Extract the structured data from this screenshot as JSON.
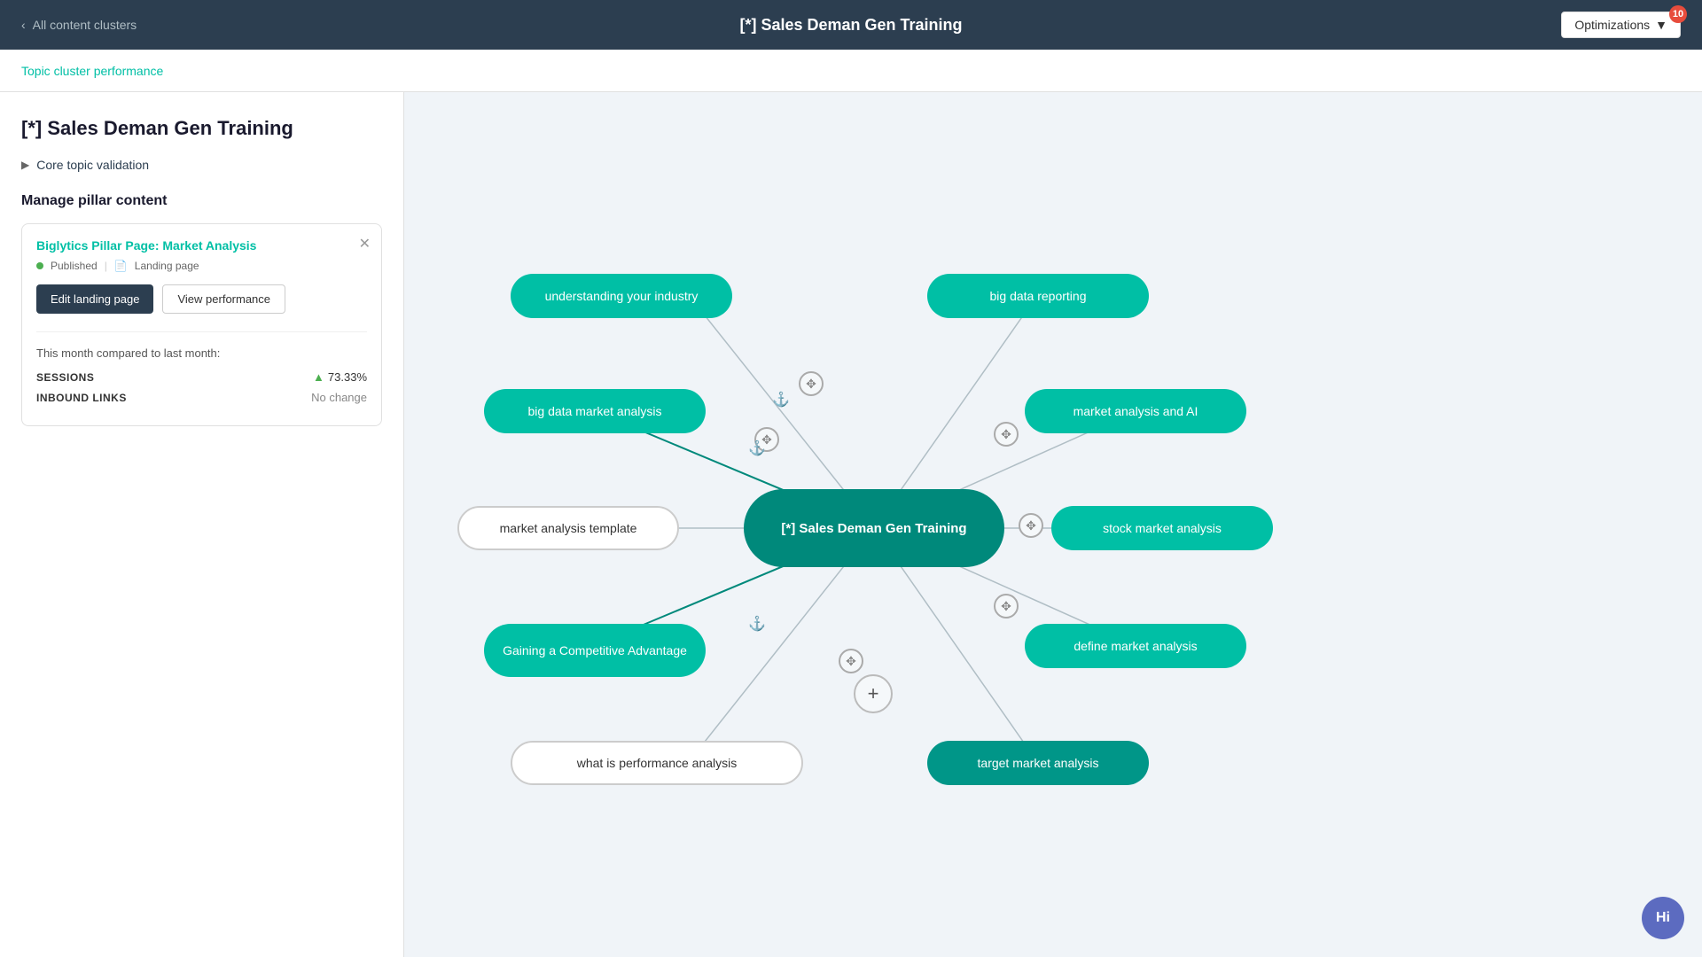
{
  "topNav": {
    "backLabel": "All content clusters",
    "title": "[*] Sales Deman Gen Training",
    "optimizationsLabel": "Optimizations",
    "badgeCount": "10"
  },
  "subNav": {
    "topicClusterLabel": "Topic cluster performance"
  },
  "sidebar": {
    "pageTitle": "[*] Sales Deman Gen Training",
    "coreTopicLabel": "Core topic validation",
    "managePillarLabel": "Manage pillar content",
    "card": {
      "title": "Biglytics Pillar Page: Market Analysis",
      "publishedLabel": "Published",
      "pageTypeLabel": "Landing page",
      "editLabel": "Edit landing page",
      "viewLabel": "View performance",
      "statsHeader": "This month compared to last month:",
      "sessionsLabel": "SESSIONS",
      "sessionsValue": "73.33%",
      "inboundLabel": "INBOUND LINKS",
      "inboundValue": "No change"
    }
  },
  "canvas": {
    "nodes": {
      "center": "[*] Sales Deman Gen Training",
      "n1": "understanding your industry",
      "n2": "big data reporting",
      "n3": "big data market analysis",
      "n4": "market analysis and AI",
      "n5": "market analysis template",
      "n6": "stock market analysis",
      "n7": "Gaining a Competitive Advantage",
      "n8": "define market analysis",
      "n9": "what is performance analysis",
      "n10": "target market analysis"
    },
    "addButtonLabel": "+",
    "helpLabel": "Hi"
  }
}
